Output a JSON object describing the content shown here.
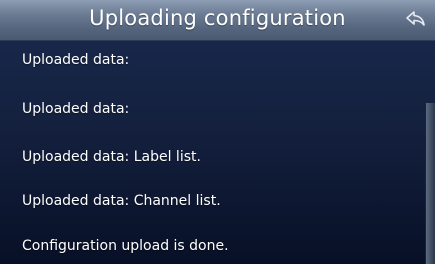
{
  "header": {
    "title": "Uploading configuration",
    "back_icon": "back-arrow-icon"
  },
  "messages": [
    "Uploaded data:",
    "Uploaded data:",
    "Uploaded data: Label list.",
    "Uploaded data: Channel list.",
    "Configuration upload is done."
  ],
  "colors": {
    "title_bar": "#6b7c94",
    "background": "#14213f",
    "text": "#ffffff"
  }
}
